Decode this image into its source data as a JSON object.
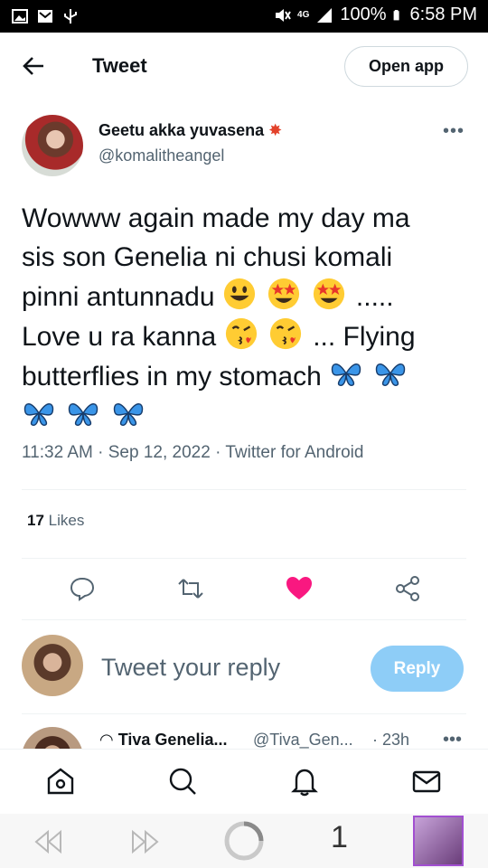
{
  "status_bar": {
    "network": "4G",
    "battery": "100%",
    "time": "6:58 PM"
  },
  "header": {
    "title": "Tweet",
    "open_app": "Open app"
  },
  "tweet": {
    "author_name": "Geetu akka yuvasena",
    "author_handle": "@komalitheangel",
    "text_line1": "Wowww again made my day ma",
    "text_line2": "sis son Genelia ni chusi komali",
    "text_line3a": "pinni antunnadu ",
    "text_line3b": ".....",
    "text_line4a": "Love u ra kanna ",
    "text_line4b": " ... Flying",
    "text_line5": "butterflies in my stomach ",
    "timestamp": "11:32 AM · Sep 12, 2022 · Twitter for Android",
    "likes_count": "17",
    "likes_label": "Likes"
  },
  "reply": {
    "placeholder": "Tweet your reply",
    "button": "Reply"
  },
  "next_tweet": {
    "name": "Tiva Genelia...",
    "handle": "@Tiva_Gen...",
    "time": "· 23h"
  },
  "browser": {
    "tab_count": "1"
  },
  "colors": {
    "like_pink": "#f91880",
    "reply_blue": "#8ecdf7",
    "thumb_border": "#a24fd1"
  }
}
